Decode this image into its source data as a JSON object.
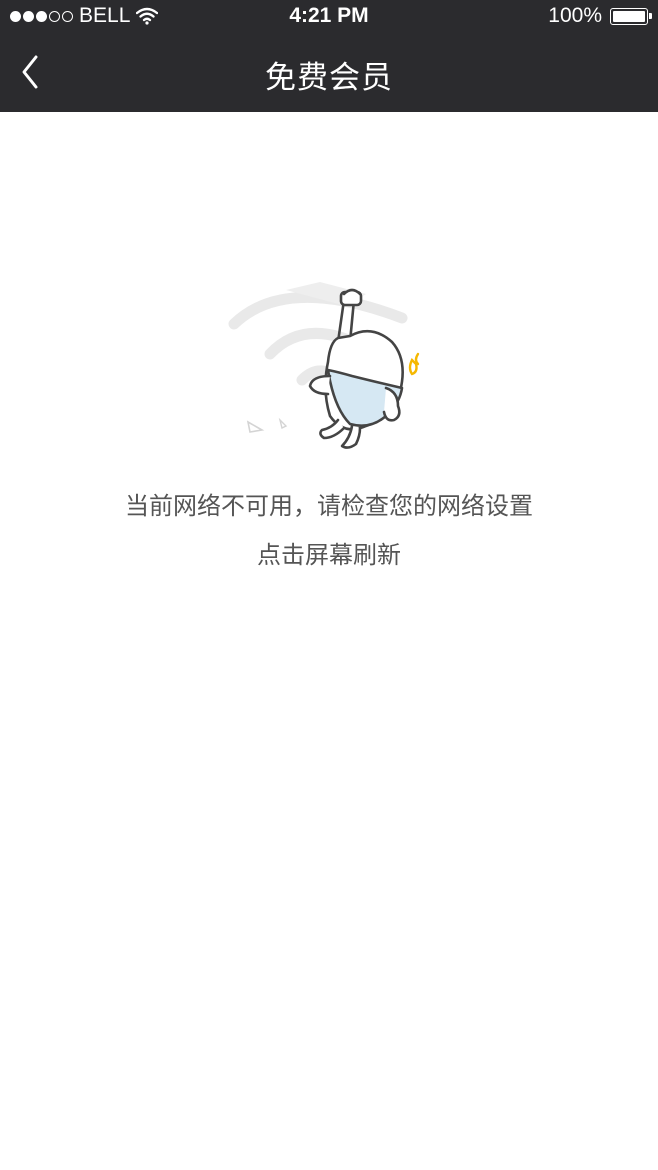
{
  "status_bar": {
    "carrier": "BELL",
    "time": "4:21 PM",
    "battery": "100%",
    "signal_filled": 3,
    "signal_total": 5,
    "battery_level": 1.0
  },
  "navbar": {
    "back_icon": "chevron-left-icon",
    "title": "免费会员"
  },
  "empty_state": {
    "illustration": "no-network-mascot-illustration",
    "message": "当前网络不可用，请检查您的网络设置",
    "refresh_label": "点击屏幕刷新"
  },
  "colors": {
    "navbar_bg": "#2b2b2e",
    "text_gray": "#555555",
    "accent_yellow": "#f5b800",
    "mascot_fill": "#d6e8f3"
  }
}
